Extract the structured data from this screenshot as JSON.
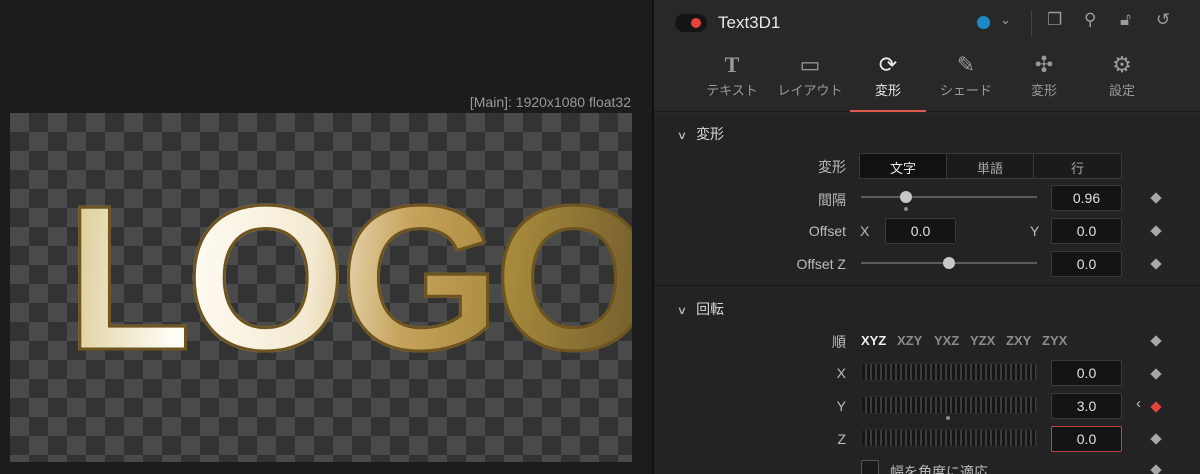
{
  "viewer": {
    "info": "[Main]: 1920x1080 float32",
    "logo_text": "LOGO"
  },
  "inspector": {
    "node_title": "Text3D1",
    "tabs": [
      {
        "label": "テキスト",
        "icon": "text-icon"
      },
      {
        "label": "レイアウト",
        "icon": "layout-icon"
      },
      {
        "label": "変形",
        "icon": "transform-icon",
        "active": true
      },
      {
        "label": "シェード",
        "icon": "brush-icon"
      },
      {
        "label": "変形",
        "icon": "3d-transform-icon"
      },
      {
        "label": "設定",
        "icon": "settings-icon"
      }
    ],
    "transform": {
      "header": "変形",
      "mode_label": "変形",
      "modes": [
        "文字",
        "単語",
        "行"
      ],
      "spacing_label": "間隔",
      "spacing_value": "0.96",
      "offset_label": "Offset",
      "x_label": "X",
      "offset_x": "0.0",
      "y_label": "Y",
      "offset_y": "0.0",
      "offset_z_label": "Offset Z",
      "offset_z": "0.0"
    },
    "rotation": {
      "header": "回転",
      "order_label": "順",
      "orders": [
        "XYZ",
        "XZY",
        "YXZ",
        "YZX",
        "ZXY",
        "ZYX"
      ],
      "x_label": "X",
      "x_value": "0.0",
      "y_label": "Y",
      "y_value": "3.0",
      "z_label": "Z",
      "z_value": "0.0",
      "checkbox_label": "幅を角度に適応"
    }
  },
  "colors": {
    "accent": "#e15a4e",
    "keyframe_active": "#e0463c",
    "node_color": "#1e88c8"
  }
}
